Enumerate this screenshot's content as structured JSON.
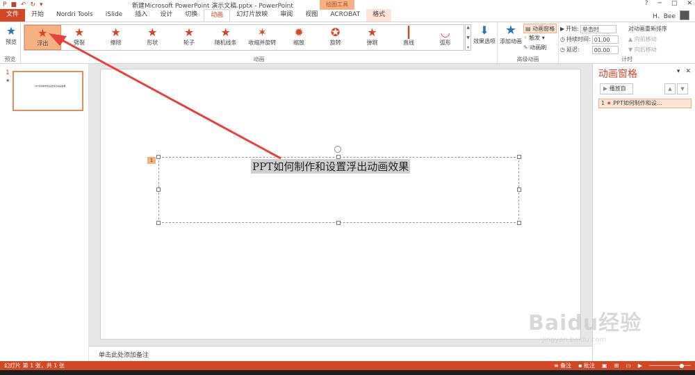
{
  "window": {
    "title": "新建Microsoft PowerPoint 演示文稿.pptx - PowerPoint",
    "context_tool": "绘图工具",
    "help": "?",
    "user": "H、Bee",
    "controls": [
      "─",
      "□",
      "✕"
    ]
  },
  "tabs": [
    {
      "label": "文件"
    },
    {
      "label": "开始"
    },
    {
      "label": "Nordri Tools"
    },
    {
      "label": "iSlide"
    },
    {
      "label": "插入"
    },
    {
      "label": "设计"
    },
    {
      "label": "切换"
    },
    {
      "label": "动画"
    },
    {
      "label": "幻灯片放映"
    },
    {
      "label": "审阅"
    },
    {
      "label": "视图"
    },
    {
      "label": "ACROBAT"
    },
    {
      "label": "格式"
    }
  ],
  "ribbon": {
    "preview_label": "预览",
    "preview_group": "预览",
    "animation_group": "动画",
    "animations": [
      {
        "label": "浮出",
        "icon": "star-icon",
        "glyph": "★"
      },
      {
        "label": "劈裂",
        "icon": "star-split-icon",
        "glyph": "★"
      },
      {
        "label": "擦除",
        "icon": "star-wipe-icon",
        "glyph": "★"
      },
      {
        "label": "形状",
        "icon": "star-shape-icon",
        "glyph": "★"
      },
      {
        "label": "轮子",
        "icon": "star-wheel-icon",
        "glyph": "★"
      },
      {
        "label": "随机线条",
        "icon": "star-lines-icon",
        "glyph": "★"
      },
      {
        "label": "收缩并旋转",
        "icon": "star-rotate-icon",
        "glyph": "✶"
      },
      {
        "label": "缩放",
        "icon": "star-zoom-icon",
        "glyph": "✹"
      },
      {
        "label": "旋转",
        "icon": "star-spin-icon",
        "glyph": "✪"
      },
      {
        "label": "弹跳",
        "icon": "star-bounce-icon",
        "glyph": "★"
      },
      {
        "label": "直线",
        "icon": "line-path-icon",
        "glyph": "┃"
      },
      {
        "label": "弧形",
        "icon": "arc-path-icon",
        "glyph": "◡"
      }
    ],
    "effect_options": "效果选项",
    "add_animation": "添加动画",
    "advanced_group": "高级动画",
    "animation_pane_btn": "动画窗格",
    "trigger": "触发",
    "painter": "动画刷",
    "timing_group": "计时",
    "start_label": "开始:",
    "start_value": "单击时",
    "duration_label": "持续时间:",
    "duration_value": "01.00",
    "delay_label": "延迟:",
    "delay_value": "00.00",
    "reorder_title": "对动画重新排序",
    "move_earlier": "向前移动",
    "move_later": "向后移动"
  },
  "thumbnails": {
    "number": "1",
    "star": "★",
    "text": "PPT如何制作和设置浮出动画效果"
  },
  "slide": {
    "text": "PPT如何制作和设置浮出动画效果",
    "anim_tag": "1"
  },
  "notes": "单击此处添加备注",
  "anim_pane": {
    "title": "动画窗格",
    "play_label": "播放自",
    "entry_number": "1",
    "entry_label": "PPT如何制作和设..."
  },
  "status": {
    "slide_info": "幻灯片 第 1 张，共 1 张",
    "notes_btn": "备注",
    "comments_btn": "批注"
  },
  "watermark": {
    "main": "Baidu经验",
    "sub": "jingyan.baidu.com"
  },
  "colors": {
    "accent": "#d24726",
    "selection": "#f4b183",
    "arrow": "#e8403a"
  }
}
